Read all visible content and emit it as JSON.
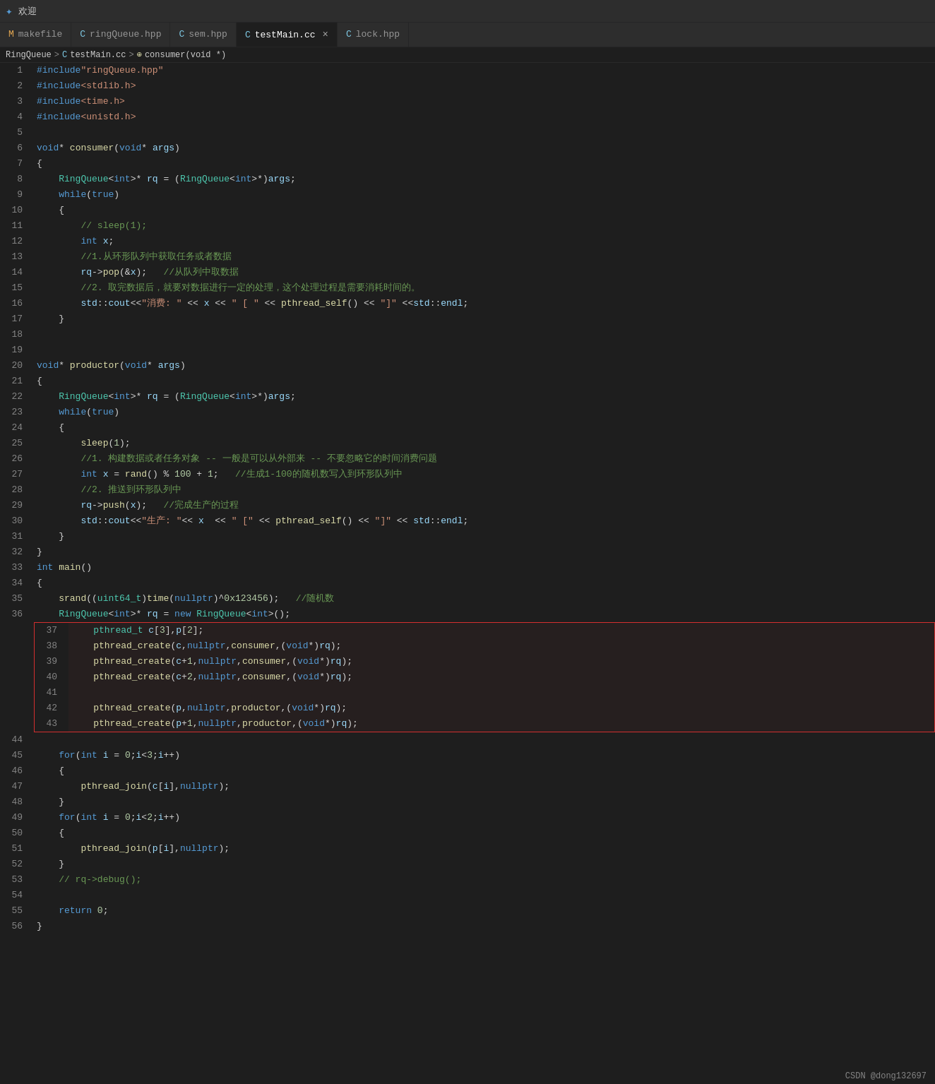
{
  "titleBar": {
    "icon": "欢迎",
    "text": "欢迎"
  },
  "tabs": [
    {
      "label": "makefile",
      "icon": "M",
      "active": false,
      "modified": false
    },
    {
      "label": "ringQueue.hpp",
      "icon": "C",
      "active": false,
      "modified": false
    },
    {
      "label": "sem.hpp",
      "icon": "C",
      "active": false,
      "modified": false
    },
    {
      "label": "testMain.cc",
      "icon": "C",
      "active": true,
      "modified": false
    },
    {
      "label": "lock.hpp",
      "icon": "C",
      "active": false,
      "modified": false
    }
  ],
  "breadcrumb": {
    "parts": [
      "RingQueue",
      "testMain.cc",
      "consumer(void *)"
    ]
  },
  "footer": {
    "text": "CSDN @dong132697"
  }
}
